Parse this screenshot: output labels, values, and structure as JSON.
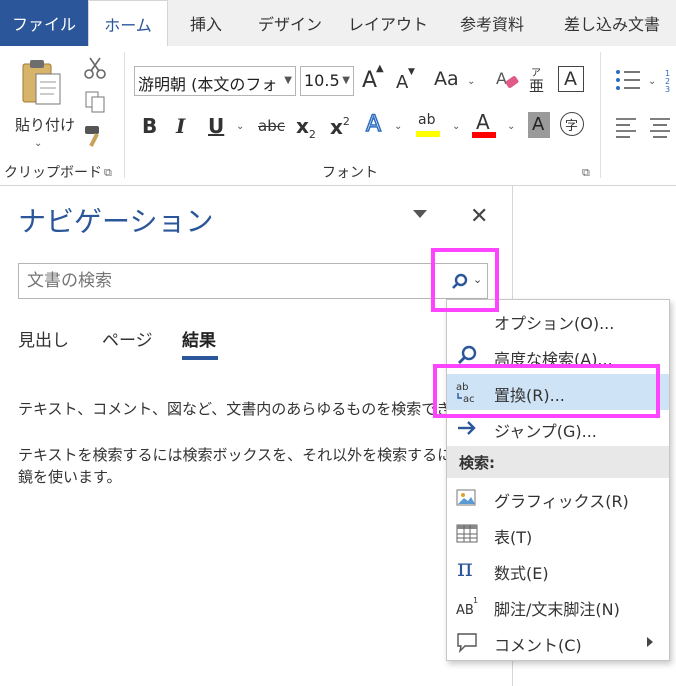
{
  "ribbon": {
    "file_tab": "ファイル",
    "tabs": [
      {
        "label": "ホーム",
        "active": true
      },
      {
        "label": "挿入",
        "active": false
      },
      {
        "label": "デザイン",
        "active": false
      },
      {
        "label": "レイアウト",
        "active": false
      },
      {
        "label": "参考資料",
        "active": false
      },
      {
        "label": "差し込み文書",
        "active": false
      }
    ],
    "clipboard": {
      "paste_label": "貼り付け",
      "group_label": "クリップボード"
    },
    "font": {
      "font_name": "游明朝 (本文のフォ",
      "font_size": "10.5",
      "group_label": "フォント",
      "grow_glyph": "A",
      "shrink_glyph": "A",
      "case_glyph": "Aa",
      "bold_glyph": "B",
      "italic_glyph": "I",
      "underline_glyph": "U",
      "strike_glyph": "abc",
      "subscript_glyph": "x",
      "subscript_sub": "2",
      "superscript_glyph": "x",
      "superscript_sup": "2",
      "effects_glyph": "A",
      "highlight_glyph": "ab",
      "color_glyph": "A",
      "shading_glyph": "A",
      "enclose_glyph": "字",
      "phonetic_top": "ア",
      "phonetic_bottom": "亜",
      "border_glyph": "A"
    },
    "colors": {
      "file_tab_bg": "#2b579a",
      "highlight_yellow": "#ffff00",
      "font_color_red": "#ff0000"
    }
  },
  "navigation": {
    "title": "ナビゲーション",
    "search_placeholder": "文書の検索",
    "tabs": [
      {
        "label": "見出し",
        "active": false
      },
      {
        "label": "ページ",
        "active": false
      },
      {
        "label": "結果",
        "active": true
      }
    ],
    "message_lines": [
      "テキスト、コメント、図など、文書内のあらゆるものを検索できます。",
      "テキストを検索するには検索ボックスを、それ以外を検索するには虫眼",
      "鏡を使います。"
    ]
  },
  "search_menu": {
    "items": [
      {
        "label": "オプション(O)...",
        "icon": "none",
        "selected": false
      },
      {
        "label": "高度な検索(A)...",
        "icon": "magnifier-icon",
        "selected": false
      },
      {
        "label": "置換(R)...",
        "icon": "replace-icon",
        "selected": true
      },
      {
        "label": "ジャンプ(G)...",
        "icon": "arrow-right-icon",
        "selected": false
      }
    ],
    "section_header": "検索:",
    "find_items": [
      {
        "label": "グラフィックス(R)",
        "icon": "graphics-icon"
      },
      {
        "label": "表(T)",
        "icon": "table-icon"
      },
      {
        "label": "数式(E)",
        "icon": "pi-icon"
      },
      {
        "label": "脚注/文末脚注(N)",
        "icon": "footnote-icon"
      },
      {
        "label": "コメント(C)",
        "icon": "comment-icon",
        "has_submenu": true
      }
    ],
    "highlight_color": "#ff44ff",
    "selected_bg": "#cfe3f7"
  }
}
